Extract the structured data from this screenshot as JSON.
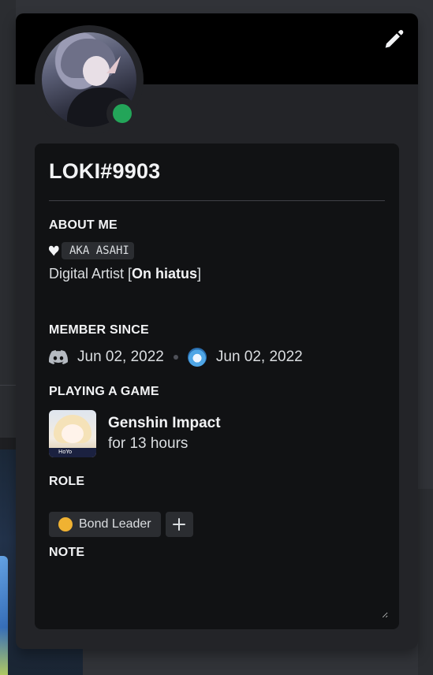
{
  "profile": {
    "username": "LOKI#9903",
    "status_color": "#23a559"
  },
  "about": {
    "title": "ABOUT ME",
    "tag_text": "AKA ASAHI",
    "line_prefix": "Digital Artist [",
    "line_bold": "On hiatus",
    "line_suffix": "]"
  },
  "member_since": {
    "title": "MEMBER SINCE",
    "discord_date": "Jun 02, 2022",
    "server_date": "Jun 02, 2022"
  },
  "activity": {
    "title": "PLAYING A GAME",
    "game_name": "Genshin Impact",
    "duration": "for 13 hours",
    "art_label": "HoYo"
  },
  "roles": {
    "title": "ROLE",
    "items": [
      {
        "name": "Bond Leader",
        "color": "#f0b232"
      }
    ]
  },
  "note": {
    "title": "NOTE",
    "value": ""
  },
  "icons": {
    "edit": "pencil-icon",
    "discord": "discord-logo-icon",
    "heart": "heart-icon",
    "add": "plus-icon"
  }
}
